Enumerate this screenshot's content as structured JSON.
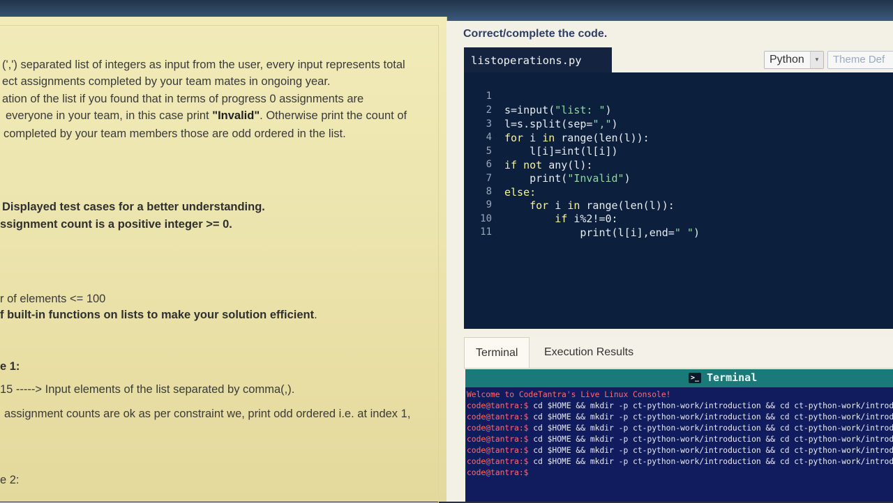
{
  "problem": {
    "lines": [
      "(',') separated list of integers as input from the user, every input represents total",
      "ect assignments completed by your team mates in ongoing year.",
      "ation of the list if you found that in terms of progress 0 assignments are",
      "everyone in your team, in this case print",
      "\"Invalid\"",
      ". Otherwise print the count of",
      "completed by your team members those are odd ordered in the list.",
      "Displayed test cases for a better understanding.",
      "ssignment count is a positive integer >= 0.",
      "r of elements <= 100",
      "f built-in functions on lists to make your solution efficient",
      ".",
      "e 1:",
      "15 -----> Input elements of the list separated by comma(,).",
      "assignment counts are ok as per constraint we, print odd ordered i.e. at index 1,",
      "e 2:"
    ]
  },
  "editor": {
    "instruction": "Correct/complete the code.",
    "filename": "listoperations.py",
    "language": "Python",
    "theme": "Theme Def",
    "line_numbers": [
      "1",
      "2",
      "3",
      "4",
      "5",
      "6",
      "7",
      "8",
      "9",
      "10",
      "11"
    ],
    "code": {
      "l1a": "s=input(",
      "l1b": "\"list: \"",
      "l1c": ")",
      "l2a": "l=s.split(sep=",
      "l2b": "\",\"",
      "l2c": ")",
      "l3a": "for",
      "l3b": " i ",
      "l3c": "in",
      "l3d": " range(len(l)):",
      "l4": "    l[i]=int(l[i])",
      "l5a": "if not",
      "l5b": " any(l):",
      "l6a": "    print(",
      "l6b": "\"Invalid\"",
      "l6c": ")",
      "l7": "else:",
      "l8a": "    for",
      "l8b": " i ",
      "l8c": "in",
      "l8d": " range(len(l)):",
      "l9a": "        if",
      "l9b": " i%2!=0:",
      "l10a": "            print(l[i],end=",
      "l10b": "\" \"",
      "l10c": ")"
    }
  },
  "tabs": {
    "terminal": "Terminal",
    "execution_results": "Execution Results"
  },
  "terminal": {
    "title": "Terminal",
    "icon": ">_",
    "welcome": "Welcome to CodeTantra's Live Linux Console!",
    "prompt": "code@tantra:$",
    "command": " cd $HOME && mkdir -p ct-python-work/introduction && cd ct-python-work/introducti",
    "command_count": 6
  },
  "colors": {
    "editor_bg": "#0c1f3c",
    "terminal_bg": "#101c5e",
    "terminal_header": "#1a7a7a",
    "keyword": "#f7f39a",
    "string": "#8fd7a6",
    "prompt": "#ff6b6b",
    "panel_bg": "#ece4ad"
  }
}
